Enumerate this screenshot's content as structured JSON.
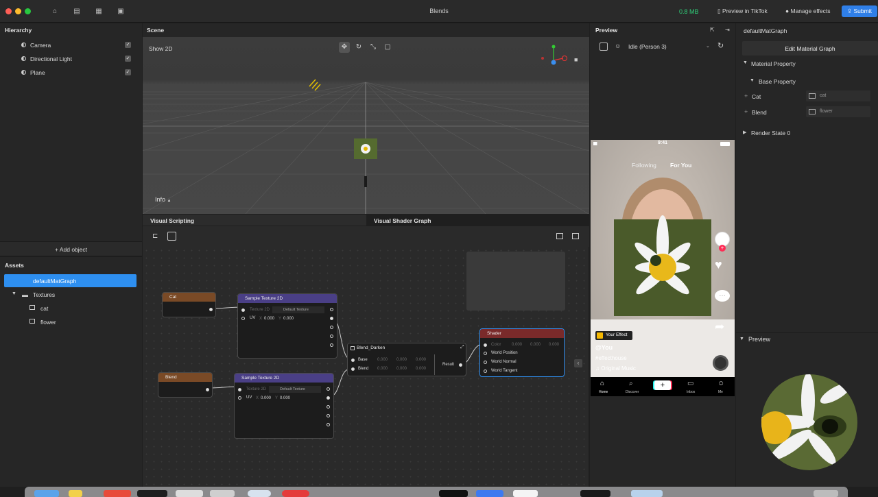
{
  "topbar": {
    "title": "Blends",
    "memory": "0.8 MB",
    "preview_tiktok": "Preview in TikTok",
    "manage_effects": "Manage effects",
    "submit": "Submit"
  },
  "hierarchy": {
    "title": "Hierarchy",
    "items": [
      {
        "label": "Camera"
      },
      {
        "label": "Directional Light"
      },
      {
        "label": "Plane"
      }
    ],
    "add_object": "+ Add object"
  },
  "assets": {
    "title": "Assets",
    "selected": "defaultMatGraph",
    "folder": "Textures",
    "files": [
      "cat",
      "flower"
    ]
  },
  "scene": {
    "title": "Scene",
    "show2d": "Show 2D",
    "info": "Info"
  },
  "tabs": {
    "visual_scripting": "Visual Scripting",
    "visual_shader_graph": "Visual Shader Graph"
  },
  "graph": {
    "cat_node": "Cat",
    "blend_node": "Blend",
    "sample1": {
      "title": "Sample Texture 2D",
      "texture_label": "Texture 2D",
      "texture_value": "Default Texture",
      "uv": "UV",
      "x_label": "X",
      "x_value": "0.000",
      "y_label": "Y",
      "y_value": "0.000"
    },
    "sample2": {
      "title": "Sample Texture 2D",
      "texture_label": "Texture 2D",
      "texture_value": "Default Texture",
      "uv": "UV",
      "x_label": "X",
      "x_value": "0.000",
      "y_label": "Y",
      "y_value": "0.000"
    },
    "blend_darken": {
      "title": "Blend_Darken",
      "base": "Base",
      "blend": "Blend",
      "result": "Result",
      "zero": "0.000"
    },
    "shader": {
      "title": "Shader",
      "color": "Color",
      "world_position": "World Position",
      "world_normal": "World Normal",
      "world_tangent": "World Tangent",
      "zero": "0.000"
    }
  },
  "preview": {
    "title": "Preview",
    "animation": "Idle (Person 3)",
    "phone": {
      "time": "9:41",
      "following": "Following",
      "for_you": "For You",
      "your_effect": "Your Effect",
      "user": "@You",
      "hashtag": "#effecthouse",
      "music": "Original Music",
      "nav": [
        "Home",
        "Discover",
        "Inbox",
        "Me"
      ]
    }
  },
  "inspector": {
    "title": "defaultMatGraph",
    "edit_button": "Edit Material Graph",
    "material_property": "Material Property",
    "base_property": "Base Property",
    "cat_label": "Cat",
    "cat_value": "cat",
    "blend_label": "Blend",
    "blend_value": "flower",
    "render_state": "Render State 0",
    "preview_title": "Preview"
  }
}
